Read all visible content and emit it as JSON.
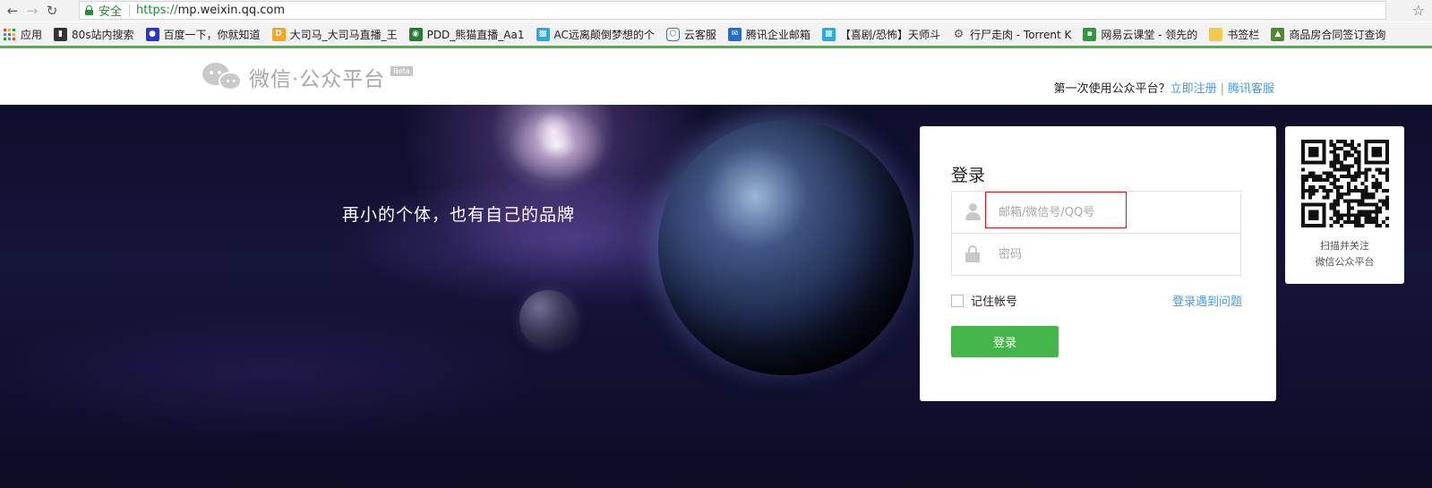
{
  "browser": {
    "secure_label": "安全",
    "url_scheme": "https://",
    "url_host": "mp.weixin.qq.com",
    "back_icon": "arrow-left-icon",
    "forward_icon": "arrow-right-icon",
    "reload_icon": "reload-icon",
    "bookmark_star_icon": "star-icon"
  },
  "bookmarks": [
    {
      "label": "应用",
      "icon": "apps-grid-icon",
      "color": "#e0453a"
    },
    {
      "label": "80s站内搜索",
      "icon": "clapperboard-icon",
      "color": "#333333"
    },
    {
      "label": "百度一下，你就知道",
      "icon": "baidu-paw-icon",
      "color": "#2932e1"
    },
    {
      "label": "大司马_大司马直播_王",
      "icon": "douyu-icon",
      "color": "#f5a623"
    },
    {
      "label": "PDD_熊猫直播_Aa1",
      "icon": "panda-icon",
      "color": "#1e7f2e"
    },
    {
      "label": "AC远离颠倒梦想的个",
      "icon": "bilibili-tv-icon",
      "color": "#23ade5"
    },
    {
      "label": "云客服",
      "icon": "hexagon-icon",
      "color": "#3a6ea5"
    },
    {
      "label": "腾讯企业邮箱",
      "icon": "mail-icon",
      "color": "#1f6fd1"
    },
    {
      "label": "【喜剧/恐怖】天师斗",
      "icon": "bilibili-tv-icon",
      "color": "#23ade5"
    },
    {
      "label": "行尸走肉 - Torrent K",
      "icon": "trophy-icon",
      "color": "#555555"
    },
    {
      "label": "网易云课堂 - 领先的",
      "icon": "book-icon",
      "color": "#2e9b3a"
    },
    {
      "label": "书签栏",
      "icon": "folder-icon",
      "color": "#f2c94c"
    },
    {
      "label": "商品房合同签订查询",
      "icon": "tree-icon",
      "color": "#4b8b2e"
    }
  ],
  "header": {
    "logo_text": "微信·公众平台",
    "beta_label": "Beta",
    "first_time_text": "第一次使用公众平台？",
    "register_link": "立即注册",
    "separator": "|",
    "support_link": "腾讯客服"
  },
  "hero": {
    "tagline": "再小的个体，也有自己的品牌"
  },
  "login": {
    "title": "登录",
    "account_placeholder": "邮箱/微信号/QQ号",
    "account_value": "",
    "password_placeholder": "密码",
    "password_value": "",
    "remember_label": "记住帐号",
    "trouble_link": "登录遇到问题",
    "submit_label": "登录"
  },
  "qr": {
    "caption_line1": "扫描并关注",
    "caption_line2": "微信公众平台"
  },
  "colors": {
    "brand_green": "#44b549",
    "link_blue": "#459ae9",
    "highlight_red": "#e0141b"
  }
}
